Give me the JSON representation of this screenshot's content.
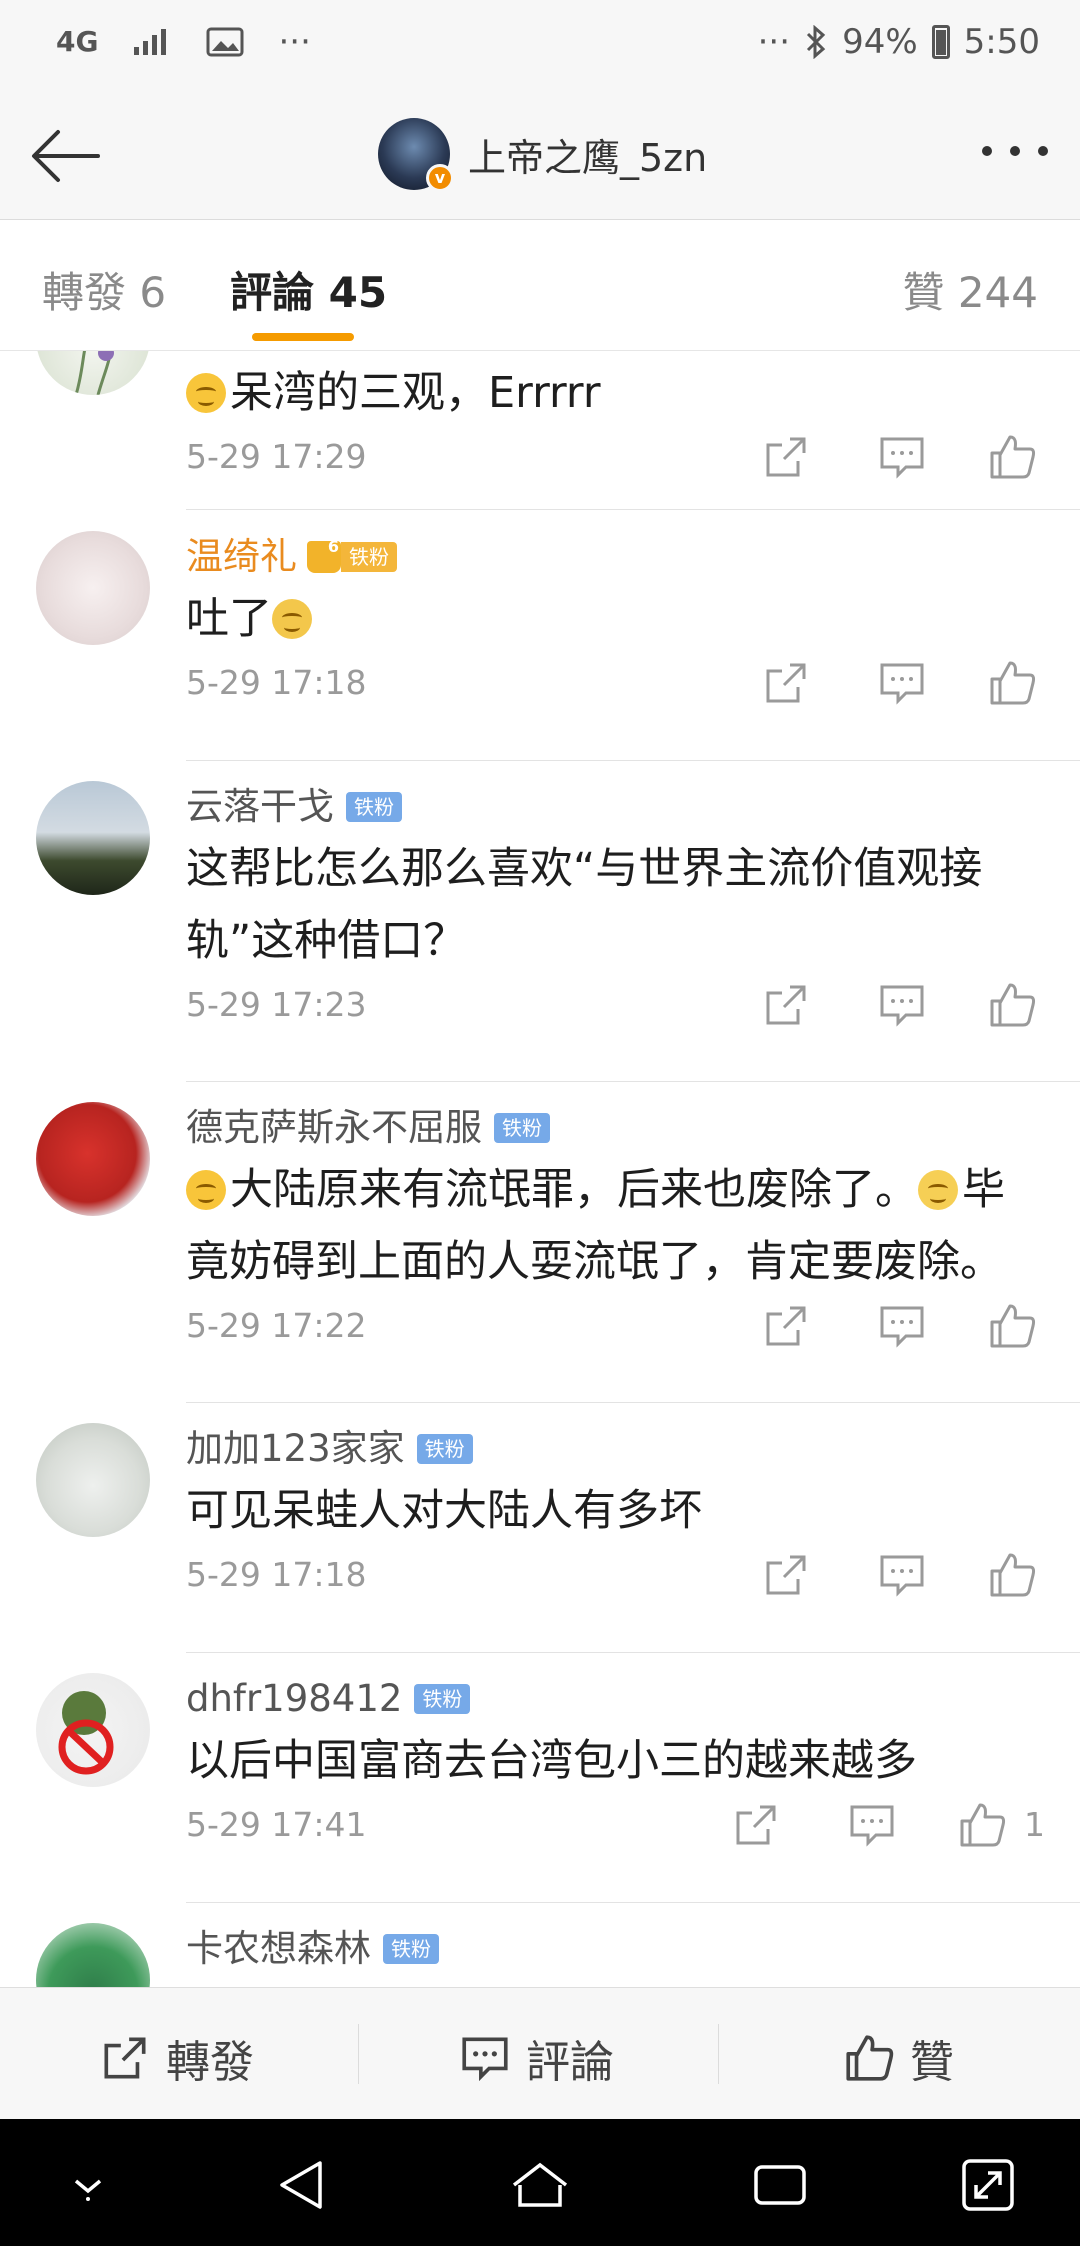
{
  "status_bar": {
    "network": "4G",
    "dots_left": "···",
    "dots_right": "···",
    "battery": "94%",
    "time": "5:50"
  },
  "header": {
    "title": "上帝之鹰_5zn",
    "verified_badge": "v"
  },
  "tabs": [
    {
      "label": "轉發 6"
    },
    {
      "label": "評論 45"
    },
    {
      "label": "贊 244"
    }
  ],
  "comments": [
    {
      "username": "",
      "text": "呆湾的三观，Errrrr",
      "time": "5-29 17:29",
      "likes": ""
    },
    {
      "username": "温绮礼",
      "badge": "铁粉",
      "crown_level": "6",
      "text": "吐了",
      "time": "5-29 17:18",
      "likes": ""
    },
    {
      "username": "云落干戈",
      "badge": "铁粉",
      "text": "这帮比怎么那么喜欢“与世界主流价值观接轨”这种借口？",
      "time": "5-29 17:23",
      "likes": ""
    },
    {
      "username": "德克萨斯永不屈服",
      "badge": "铁粉",
      "text_a": "大陆原来有流氓罪，后来也废除了。",
      "text_b": "毕竟妨碍到上面的人耍流氓了，肯定要废除。",
      "time": "5-29 17:22",
      "likes": ""
    },
    {
      "username": "加加123家家",
      "badge": "铁粉",
      "text": "可见呆蛙人对大陆人有多坏",
      "time": "5-29 17:18",
      "likes": ""
    },
    {
      "username": "dhfr198412",
      "badge": "铁粉",
      "text": "以后中国富商去台湾包小三的越来越多",
      "time": "5-29 17:41",
      "likes": "1"
    },
    {
      "username": "卡农想森林",
      "badge": "铁粉",
      "text": "",
      "time": "",
      "likes": ""
    }
  ],
  "bottom_bar": {
    "repost": "轉發",
    "comment": "評論",
    "like": "贊"
  },
  "colors": {
    "accent_orange": "#f59b00",
    "badge_blue": "#76a9e8",
    "username_orange": "#e98b1f"
  }
}
